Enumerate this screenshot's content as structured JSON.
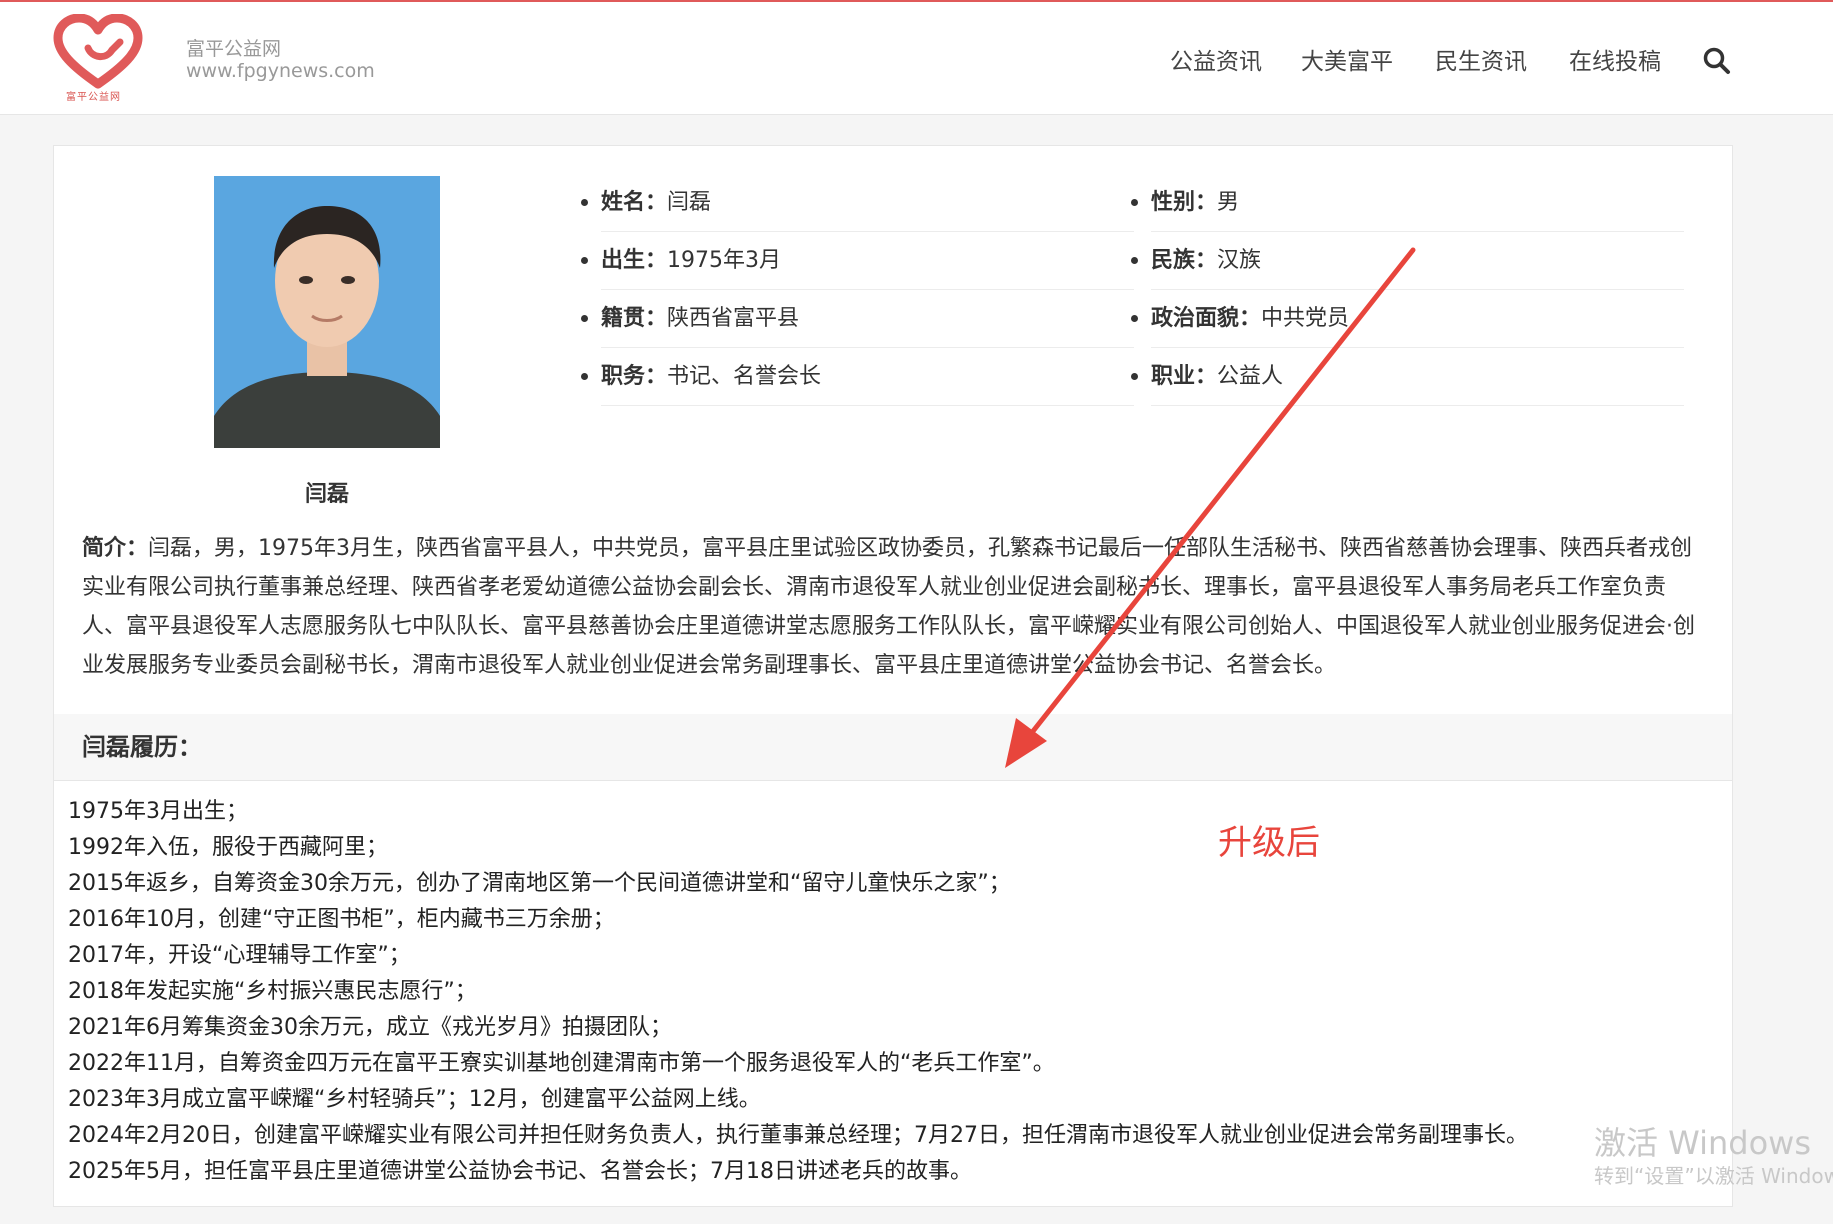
{
  "header": {
    "logo_caption": "富平公益网",
    "site_name": "富平公益网",
    "site_url": "www.fpgynews.com",
    "nav": [
      "公益资讯",
      "大美富平",
      "民生资讯",
      "在线投稿"
    ],
    "accent_color": "#e05a5a"
  },
  "profile": {
    "photo_caption": "闫磊",
    "attributes": [
      {
        "label": "姓名",
        "value": "闫磊"
      },
      {
        "label": "性别",
        "value": "男"
      },
      {
        "label": "出生",
        "value": "1975年3月"
      },
      {
        "label": "民族",
        "value": "汉族"
      },
      {
        "label": "籍贯",
        "value": "陕西省富平县"
      },
      {
        "label": "政治面貌",
        "value": "中共党员"
      },
      {
        "label": "职务",
        "value": "书记、名誉会长"
      },
      {
        "label": "职业",
        "value": "公益人"
      }
    ],
    "colon": "：",
    "intro_label": "简介：",
    "intro_text": "闫磊，男，1975年3月生，陕西省富平县人，中共党员，富平县庄里试验区政协委员，孔繁森书记最后一任部队生活秘书、陕西省慈善协会理事、陕西兵者戎创实业有限公司执行董事兼总经理、陕西省孝老爱幼道德公益协会副会长、渭南市退役军人就业创业促进会副秘书长、理事长，富平县退役军人事务局老兵工作室负责人、富平县退役军人志愿服务队七中队队长、富平县慈善协会庄里道德讲堂志愿服务工作队队长，富平嵘耀实业有限公司创始人、中国退役军人就业创业服务促进会·创业发展服务专业委员会副秘书长，渭南市退役军人就业创业促进会常务副理事长、富平县庄里道德讲堂公益协会书记、名誉会长。"
  },
  "resume": {
    "title": "闫磊履历：",
    "items": [
      "1975年3月出生；",
      "1992年入伍，服役于西藏阿里；",
      "2015年返乡，自筹资金30余万元，创办了渭南地区第一个民间道德讲堂和“留守儿童快乐之家”；",
      "2016年10月，创建“守正图书柜”，柜内藏书三万余册；",
      "2017年，开设“心理辅导工作室”；",
      "2018年发起实施“乡村振兴惠民志愿行”；",
      "2021年6月筹集资金30余万元，成立《戎光岁月》拍摄团队；",
      "2022年11月，自筹资金四万元在富平王寮实训基地创建渭南市第一个服务退役军人的“老兵工作室”。",
      "2023年3月成立富平嵘耀“乡村轻骑兵”；12月，创建富平公益网上线。",
      "2024年2月20日，创建富平嵘耀实业有限公司并担任财务负责人，执行董事兼总经理；7月27日，担任渭南市退役军人就业创业促进会常务副理事长。",
      "2025年5月，担任富平县庄里道德讲堂公益协会书记、名誉会长；7月18日讲述老兵的故事。"
    ]
  },
  "annotation": {
    "text": "升级后",
    "color": "#e8453c"
  },
  "watermark": {
    "line1": "激活 Windows",
    "line2": "转到“设置”以激活 Windows。"
  }
}
